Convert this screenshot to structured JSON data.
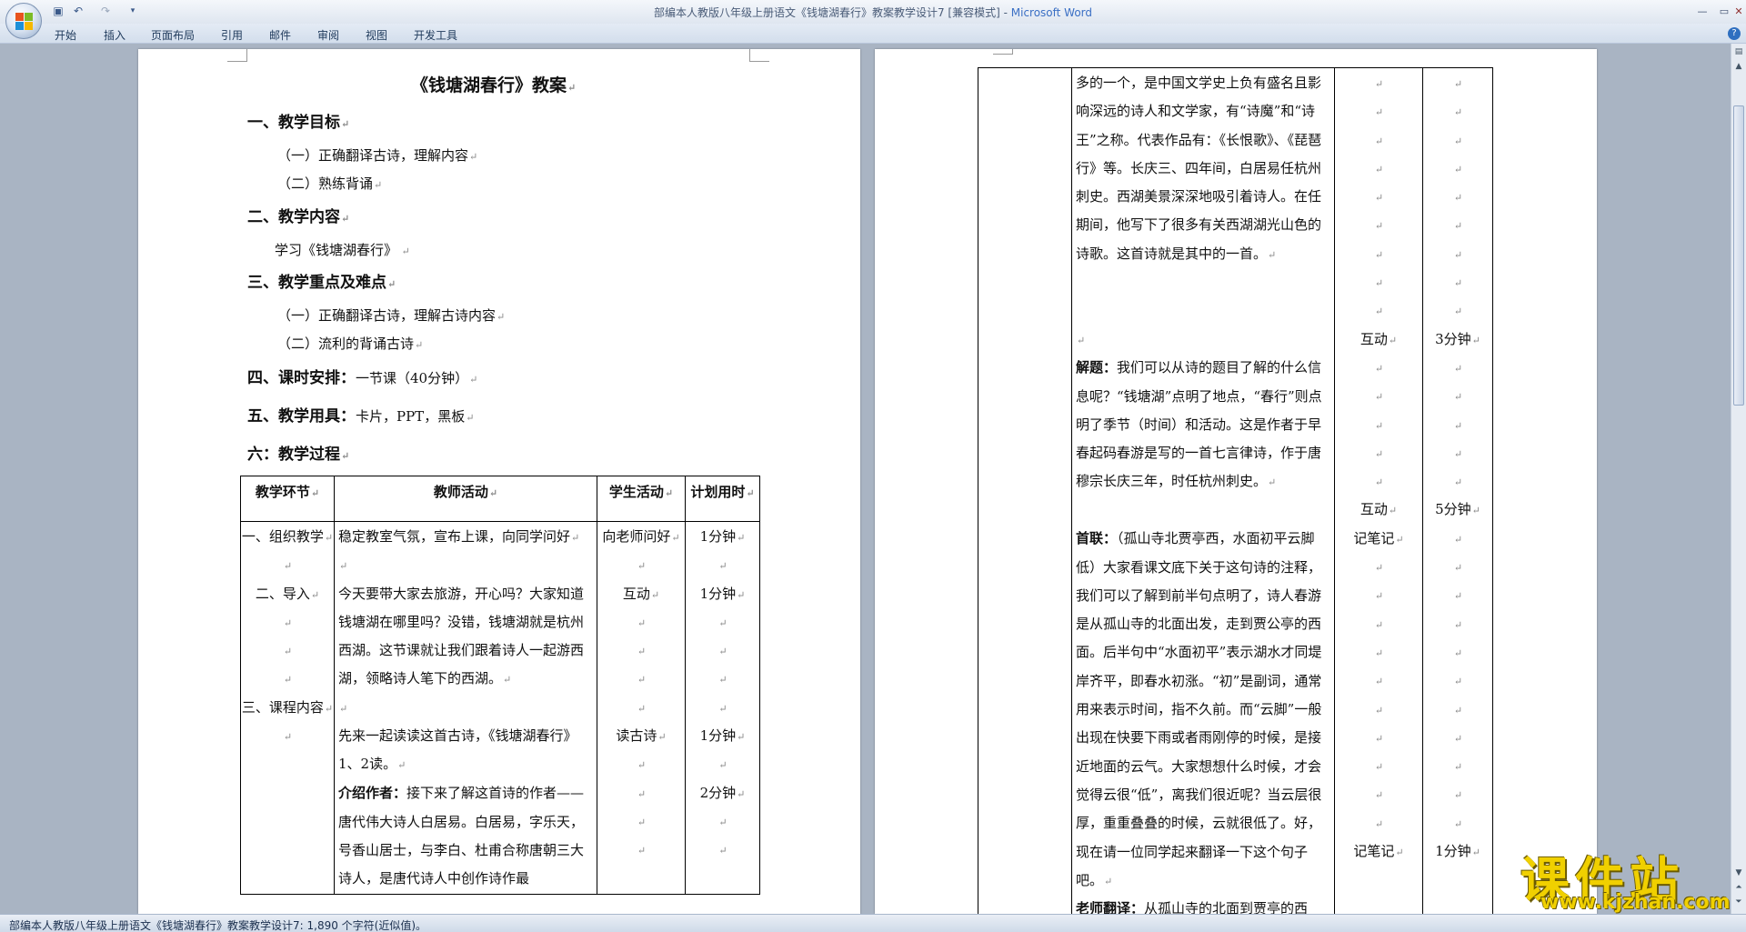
{
  "window": {
    "title": "部编本人教版八年级上册语文《钱塘湖春行》教案教学设计7 [兼容模式] - ",
    "app_name": "Microsoft Word"
  },
  "menu": [
    "开始",
    "插入",
    "页面布局",
    "引用",
    "邮件",
    "审阅",
    "视图",
    "开发工具"
  ],
  "doc": {
    "title": "《钱塘湖春行》教案",
    "s1": "一、教学目标",
    "s1a": "（一）正确翻译古诗，理解内容",
    "s1b": "（二）熟练背诵",
    "s2": "二、教学内容",
    "s2a": "学习《钱塘湖春行》",
    "s3": "三、教学重点及难点",
    "s3a": "（一）正确翻译古诗，理解古诗内容",
    "s3b": "（二）流利的背诵古诗",
    "s4_label": "四、课时安排：",
    "s4_value": "一节课（40分钟）",
    "s5_label": "五、教学用具：",
    "s5_value": "卡片，PPT，黑板",
    "s6": "六：教学过程"
  },
  "table1": {
    "headers": [
      "教学环节",
      "教师活动",
      "学生活动",
      "计划用时"
    ],
    "r1": {
      "c1": "一、组织教学",
      "c2": "稳定教室气氛，宣布上课，向同学问好",
      "c3": "向老师问好",
      "c4": "1分钟"
    },
    "r2": {
      "c1": "二、导入",
      "c2": "今天要带大家去旅游，开心吗？大家知道钱塘湖在哪里吗？没错，钱塘湖就是杭州西湖。这节课就让我们跟着诗人一起游西湖，领略诗人笔下的西湖。",
      "c3": "互动",
      "c4": "1分钟"
    },
    "r3": {
      "c1": "三、课程内容",
      "c2": "先来一起读读这首古诗，《钱塘湖春行》1、2读。",
      "c3": "读古诗",
      "c4": "1分钟"
    },
    "r4": {
      "c2_label": "介绍作者：",
      "c2": "接下来了解这首诗的作者——唐代伟大诗人白居易。白居易，字乐天，号香山居士，与李白、杜甫合称唐朝三大诗人，是唐代诗人中创作诗作最",
      "c4": "2分钟"
    }
  },
  "table2": {
    "r1": {
      "c2": "多的一个，是中国文学史上负有盛名且影响深远的诗人和文学家，有“诗魔”和“诗王”之称。代表作品有：《长恨歌》、《琵琶行》等。长庆三、四年间，白居易任杭州刺史。西湖美景深深地吸引着诗人。在任期间，他写下了很多有关西湖湖光山色的诗歌。这首诗就是其中的一首。"
    },
    "r2": {
      "c2_label": "解题：",
      "c2": "我们可以从诗的题目了解的什么信息呢？“钱塘湖”点明了地点，“春行”则点明了季节（时间）和活动。这是作者于早春起码春游是写的一首七言律诗，作于唐穆宗长庆三年，时任杭州刺史。",
      "c3": "互动",
      "c4": "3分钟"
    },
    "r3": {
      "c2_label": "首联：",
      "c2": "（孤山寺北贾亭西，水面初平云脚低）大家看课文底下关于这句诗的注释，我们可以了解到前半句点明了，诗人春游是从孤山寺的北面出发，走到贾公亭的西面。后半句中“水面初平”表示湖水才同堤岸齐平，即春水初涨。“初”是副词，通常用来表示时间，指不久前。而“云脚”一般出现在快要下雨或者雨刚停的时候，是接近地面的云气。大家想想什么时候，才会觉得云很“低”，离我们很近呢？当云层很厚，重重叠叠的时候，云就很低了。好，现在请一位同学起来翻译一下这个句子吧。",
      "c3a": "互动",
      "c3b": "记笔记",
      "c4": "5分钟"
    },
    "r4": {
      "c2_label": "老师翻译：",
      "c2": "从孤山寺的北面到贾亭的西",
      "c3": "记笔记",
      "c4": "1分钟"
    }
  },
  "status": "部编本人教版八年级上册语文《钱塘湖春行》教案教学设计7: 1,890 个字符(近似值)。",
  "watermark": {
    "text": "课件站",
    "url": "www.kjzhan.com"
  }
}
